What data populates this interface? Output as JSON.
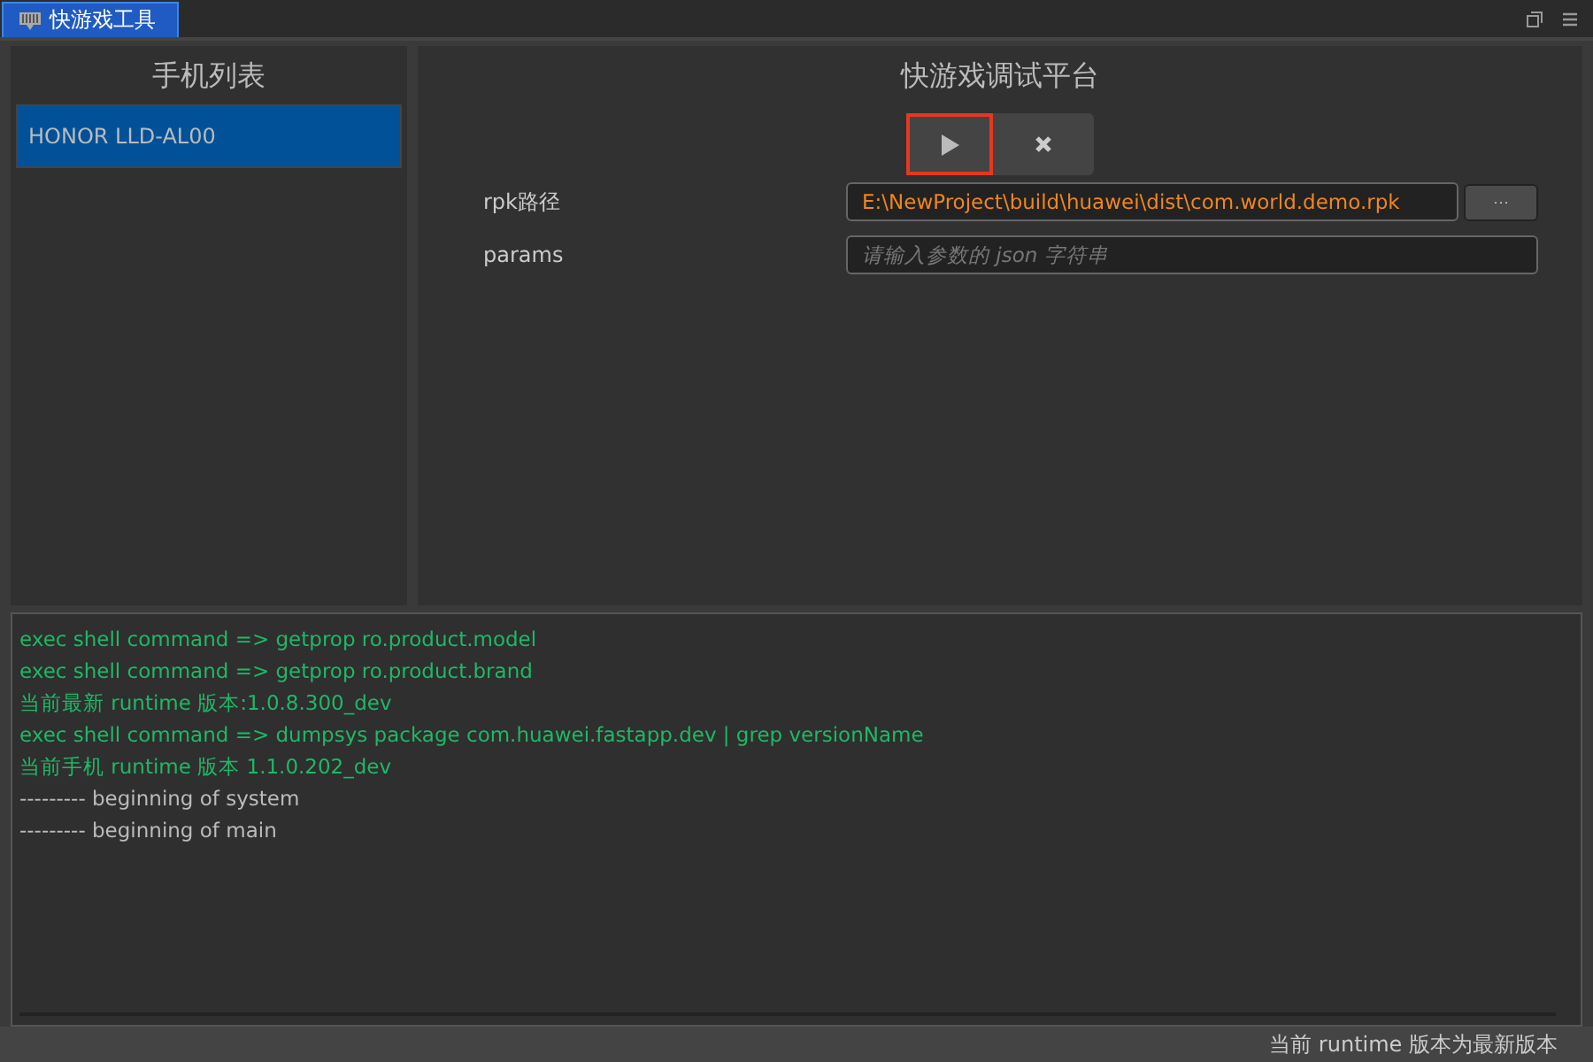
{
  "window": {
    "tab": "快游戏工具"
  },
  "phone_list": {
    "title": "手机列表",
    "items": [
      {
        "label": "HONOR LLD-AL00",
        "selected": true
      }
    ]
  },
  "debug": {
    "title": "快游戏调试平台",
    "controls": [
      {
        "kind": "play",
        "selected": true
      },
      {
        "kind": "stop",
        "selected": false
      }
    ],
    "rpk": {
      "label": "rpk路径",
      "value": "E:\\NewProject\\build\\huawei\\dist\\com.world.demo.rpk",
      "browse": "···"
    },
    "params": {
      "label": "params",
      "placeholder": "请输入参数的 json 字符串"
    }
  },
  "log": [
    {
      "kind": "command",
      "text": "exec shell command => getprop ro.product.model"
    },
    {
      "kind": "command",
      "text": "exec shell command => getprop ro.product.brand"
    },
    {
      "kind": "command",
      "text": "当前最新 runtime 版本:1.0.8.300_dev"
    },
    {
      "kind": "command",
      "text": "exec shell command => dumpsys package com.huawei.fastapp.dev | grep versionName"
    },
    {
      "kind": "command",
      "text": "当前手机 runtime 版本 1.1.0.202_dev"
    },
    {
      "kind": "info",
      "text": "--------- beginning of system"
    },
    {
      "kind": "info",
      "text": "--------- beginning of main"
    }
  ],
  "status_bar": "当前 runtime 版本为最新版本"
}
